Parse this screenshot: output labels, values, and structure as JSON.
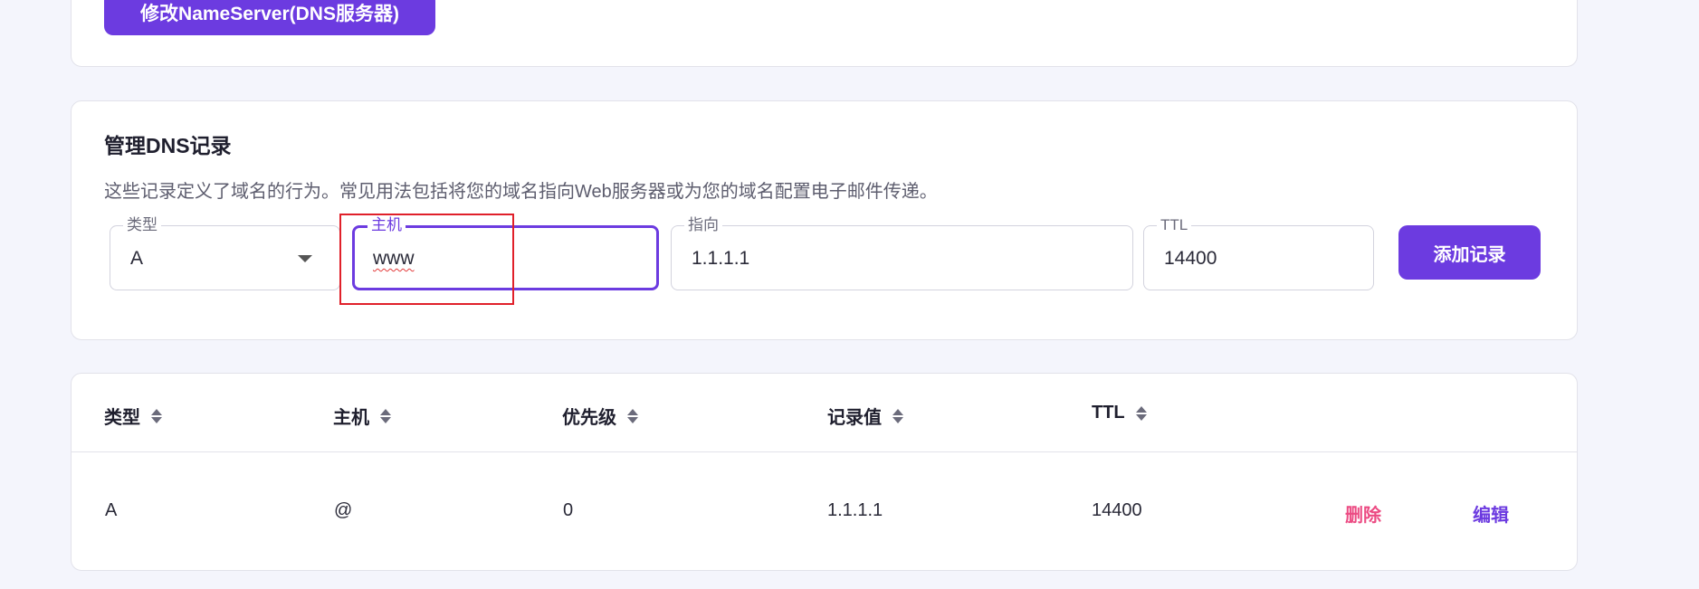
{
  "nameserver": {
    "button_label": "修改NameServer(DNS服务器)"
  },
  "manage": {
    "title": "管理DNS记录",
    "description": "这些记录定义了域名的行为。常见用法包括将您的域名指向Web服务器或为您的域名配置电子邮件传递。",
    "form": {
      "type_label": "类型",
      "type_value": "A",
      "host_label": "主机",
      "host_value": "www",
      "target_label": "指向",
      "target_value": "1.1.1.1",
      "ttl_label": "TTL",
      "ttl_value": "14400",
      "add_button": "添加记录"
    }
  },
  "table": {
    "headers": [
      "类型",
      "主机",
      "优先级",
      "记录值",
      "TTL"
    ],
    "rows": [
      {
        "type": "A",
        "host": "@",
        "priority": "0",
        "value": "1.1.1.1",
        "ttl": "14400",
        "delete": "删除",
        "edit": "编辑"
      }
    ]
  },
  "colors": {
    "accent": "#6c3be0",
    "delete": "#ec4b83",
    "highlight": "#e0202a",
    "background": "#f4f5fc"
  }
}
